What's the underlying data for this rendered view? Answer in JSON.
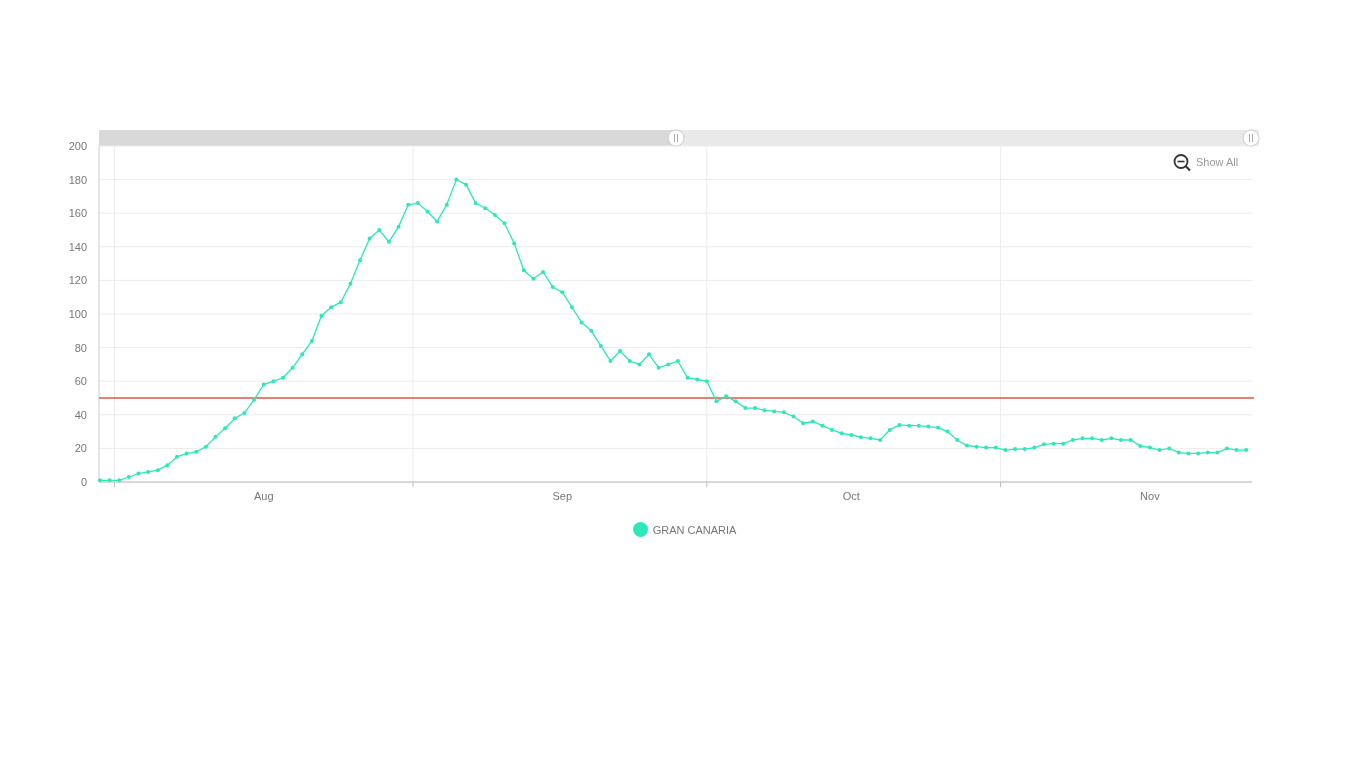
{
  "chart": {
    "zoom_button": {
      "label": "Show All"
    },
    "chart_data": {
      "type": "line",
      "ylim": [
        0,
        200
      ],
      "yticks": [
        0,
        20,
        40,
        60,
        80,
        100,
        120,
        140,
        160,
        180,
        200
      ],
      "grid": true,
      "ref_lines": [
        {
          "axis": "y",
          "value": 50,
          "color": "#e0554a"
        }
      ],
      "categories": [
        null,
        null,
        null,
        null,
        null,
        null,
        null,
        null,
        null,
        null,
        null,
        null,
        null,
        null,
        null,
        null,
        null,
        "Aug",
        null,
        null,
        null,
        null,
        null,
        null,
        null,
        null,
        null,
        null,
        null,
        null,
        null,
        null,
        null,
        null,
        null,
        null,
        null,
        null,
        null,
        null,
        null,
        null,
        null,
        null,
        null,
        null,
        null,
        null,
        "Sep",
        null,
        null,
        null,
        null,
        null,
        null,
        null,
        null,
        null,
        null,
        null,
        null,
        null,
        null,
        null,
        null,
        null,
        null,
        null,
        null,
        null,
        null,
        null,
        null,
        null,
        null,
        null,
        null,
        null,
        "Oct",
        null,
        null,
        null,
        null,
        null,
        null,
        null,
        null,
        null,
        null,
        null,
        null,
        null,
        null,
        null,
        null,
        null,
        null,
        null,
        null,
        null,
        null,
        null,
        null,
        null,
        null,
        null,
        null,
        null,
        null,
        "Nov",
        null,
        null,
        null,
        null,
        null,
        null,
        null,
        null,
        null,
        null
      ],
      "series": [
        {
          "name": "GRAN CANARIA",
          "color": "#2de8b9",
          "values": [
            1,
            1,
            1,
            3,
            5,
            6,
            7,
            10,
            15,
            17,
            18,
            21,
            27,
            32,
            38,
            41,
            49,
            58,
            60,
            62,
            68,
            76,
            84,
            99,
            104,
            107,
            118,
            132,
            145,
            150,
            143,
            152,
            165,
            166,
            161,
            155,
            165,
            180,
            177,
            166,
            163,
            159,
            154,
            142,
            126,
            121,
            125,
            116,
            113,
            104,
            95,
            90,
            81,
            72,
            78,
            72,
            70,
            76,
            68,
            70,
            72,
            62,
            61,
            60,
            48,
            51,
            48,
            44,
            44,
            42.7,
            42,
            41.5,
            39,
            35,
            36,
            33.5,
            31,
            29,
            28,
            26.7,
            26,
            25,
            31,
            34,
            33.5,
            33.5,
            33,
            32.4,
            30,
            25,
            21.7,
            21,
            20.5,
            20.5,
            19,
            19.6,
            19.6,
            20.5,
            22.4,
            22.8,
            22.8,
            25,
            26,
            26,
            25,
            26,
            25,
            25,
            21.5,
            20.5,
            19,
            20,
            17.5,
            17,
            17,
            17.5,
            17.5,
            20,
            19,
            19
          ]
        }
      ]
    }
  }
}
